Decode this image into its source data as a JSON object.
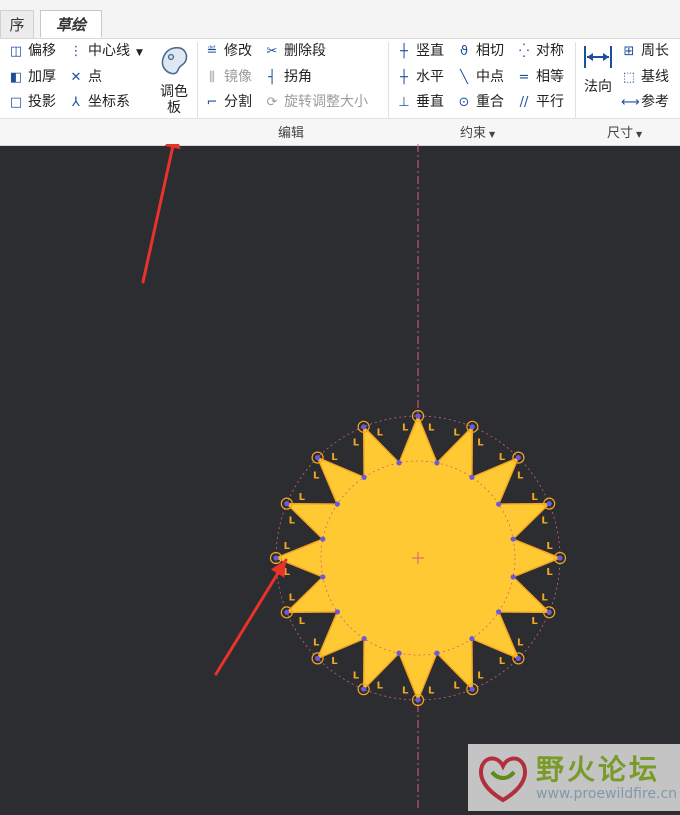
{
  "tabs": {
    "prev": "序",
    "active": "草绘"
  },
  "setup": {
    "offset": "偏移",
    "thicken": "加厚",
    "project": "投影",
    "centerline": "中心线",
    "point": "点",
    "coordsys": "坐标系",
    "palette_line1": "调色",
    "palette_line2": "板"
  },
  "edit": {
    "modify": "修改",
    "delete_segment": "删除段",
    "mirror": "镜像",
    "corner": "拐角",
    "divide": "分割",
    "rotate_resize": "旋转调整大小",
    "group_label": "编辑"
  },
  "constrain": {
    "vertical": "竖直",
    "tangent": "相切",
    "symmetric": "对称",
    "horizontal": "水平",
    "midpoint": "中点",
    "equal": "相等",
    "perpendicular": "垂直",
    "coincident": "重合",
    "parallel": "平行",
    "group_label": "约束"
  },
  "dimension": {
    "normal": "法向",
    "perimeter": "周长",
    "baseline": "基线",
    "reference": "参考",
    "group_label": "尺寸"
  },
  "watermark": {
    "title": "野火论坛",
    "url": "www.proewildfire.cn"
  },
  "colors": {
    "canvas_bg": "#2b2d30",
    "sketch_fill": "#ffc933",
    "sketch_outline": "#f5a623",
    "center_axis": "#d4607a",
    "vertex": "#6b5bd6",
    "arrow": "#e8322a"
  }
}
